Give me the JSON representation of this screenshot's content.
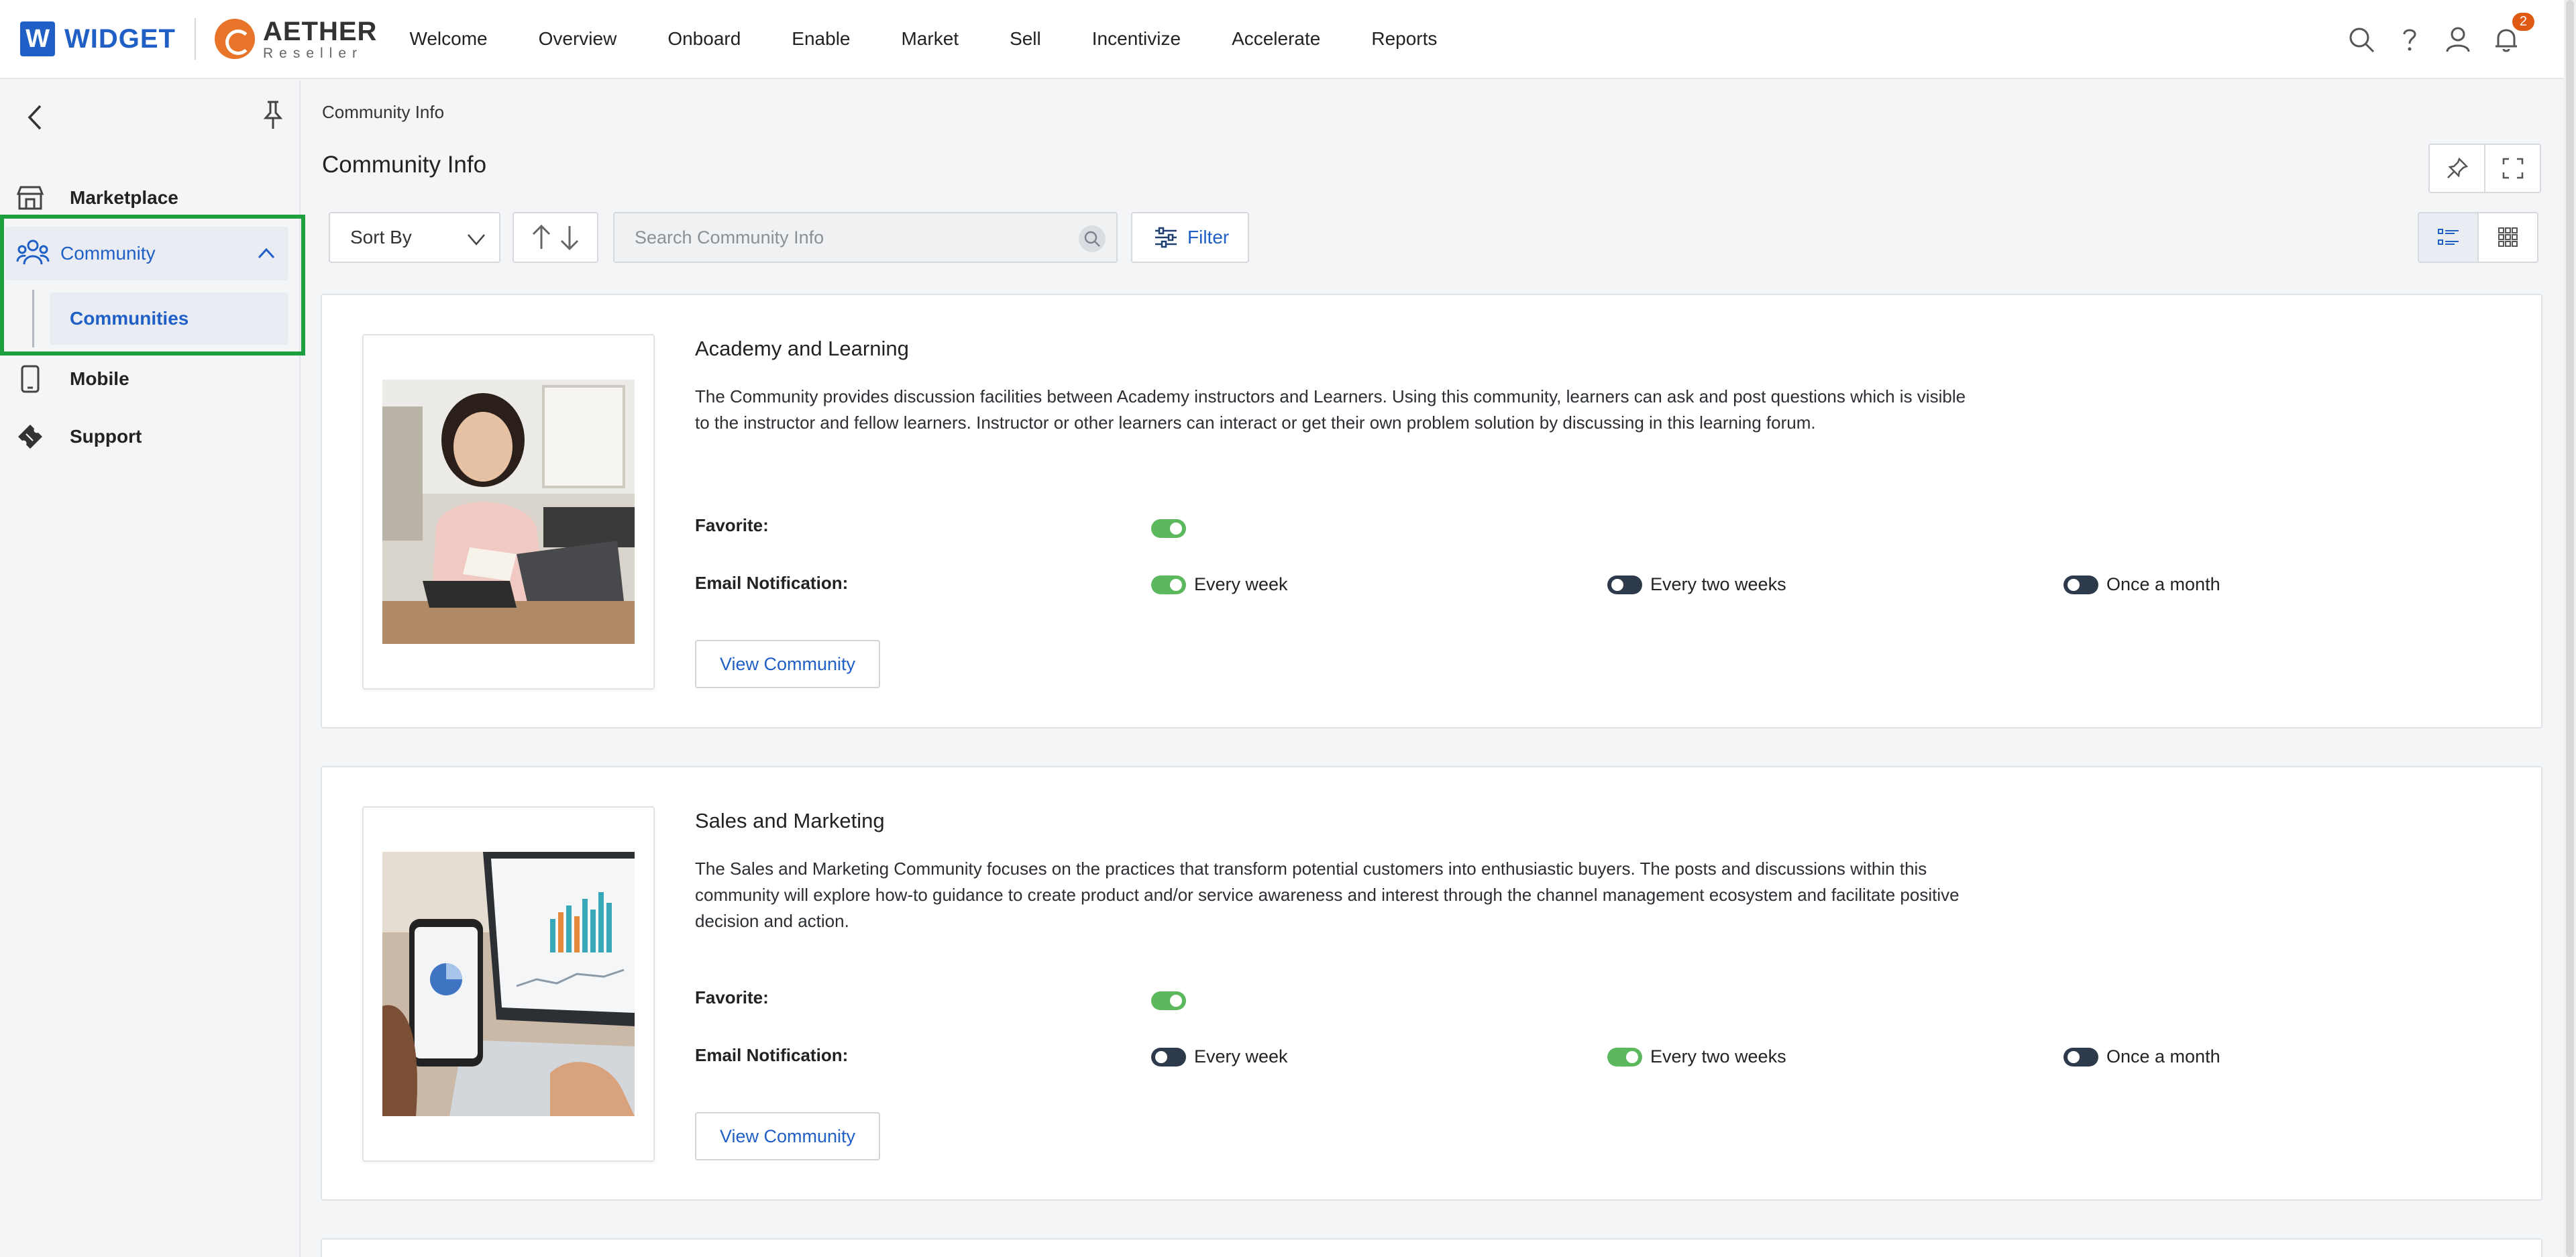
{
  "brand": {
    "widget": "WIDGET",
    "widget_mark": "W",
    "aether": "AETHER",
    "aether_sub": "Reseller"
  },
  "nav": [
    "Welcome",
    "Overview",
    "Onboard",
    "Enable",
    "Market",
    "Sell",
    "Incentivize",
    "Accelerate",
    "Reports"
  ],
  "notifications": {
    "count": "2"
  },
  "sidebar": {
    "items": [
      {
        "label": "Marketplace",
        "icon": "store-icon"
      },
      {
        "label": "Community",
        "icon": "community-icon",
        "expanded": true
      },
      {
        "label": "Mobile",
        "icon": "mobile-icon"
      },
      {
        "label": "Support",
        "icon": "ticket-icon"
      }
    ],
    "sub_items": [
      {
        "label": "Communities",
        "selected": true
      }
    ]
  },
  "breadcrumb": "Community Info",
  "page_title": "Community Info",
  "toolbar": {
    "sort_label": "Sort By",
    "search_placeholder": "Search Community Info",
    "filter_label": "Filter",
    "view_mode": "list"
  },
  "labels": {
    "favorite": "Favorite:",
    "email": "Email Notification:",
    "view_button": "View Community"
  },
  "communities": [
    {
      "title": "Academy and Learning",
      "description": "The Community provides discussion facilities between Academy instructors and Learners. Using this community, learners can ask and post questions which is visible to the instructor and fellow learners. Instructor or other learners can interact or get their own problem solution by discussing in this learning forum.",
      "favorite": true,
      "notifications": [
        {
          "label": "Every week",
          "on": true
        },
        {
          "label": "Every two weeks",
          "on": false
        },
        {
          "label": "Once a month",
          "on": false
        }
      ]
    },
    {
      "title": "Sales and Marketing",
      "description": "The Sales and Marketing Community focuses on the practices that transform potential customers into enthusiastic buyers. The posts and discussions within this community will explore how-to guidance to create product and/or service awareness and interest through the channel management ecosystem and facilitate positive decision and action.",
      "favorite": true,
      "notifications": [
        {
          "label": "Every week",
          "on": false
        },
        {
          "label": "Every two weeks",
          "on": true
        },
        {
          "label": "Once a month",
          "on": false
        }
      ]
    }
  ],
  "colors": {
    "accent": "#1f5fc6",
    "brand_orange": "#e8742a",
    "toggle_on": "#5cb85c",
    "toggle_off": "#2d3a4b",
    "highlight": "#1fa040"
  }
}
